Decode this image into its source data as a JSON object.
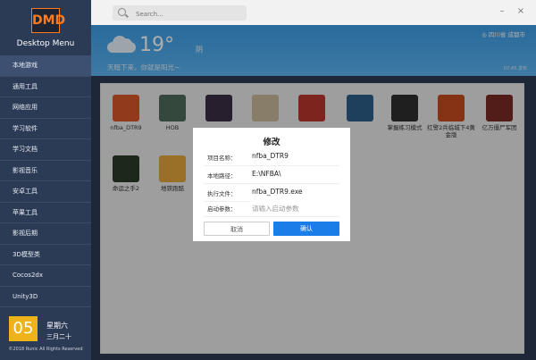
{
  "sidebar": {
    "logo_text": "DMD",
    "app_title": "Desktop Menu",
    "items": [
      {
        "label": "本地游戏",
        "active": true
      },
      {
        "label": "通用工具"
      },
      {
        "label": "网络应用"
      },
      {
        "label": "学习软件"
      },
      {
        "label": "学习文档"
      },
      {
        "label": "影视音乐"
      },
      {
        "label": "安卓工具"
      },
      {
        "label": "苹果工具"
      },
      {
        "label": "影视后期"
      },
      {
        "label": "3D模型类"
      },
      {
        "label": "Cocos2dx"
      },
      {
        "label": "Unity3D"
      }
    ],
    "date_day": "05",
    "weekday": "星期六",
    "lunar_date": "三月二十",
    "copyright": "©2018 Runic All Rights Reserved"
  },
  "topbar": {
    "search_placeholder": "Search...",
    "minimize": "–",
    "close": "×"
  },
  "weather": {
    "temperature": "19°",
    "condition": "阴",
    "slogan": "天暗下来，你就是阳光~",
    "location": "四川省 成都市",
    "publish_time": "07:45 发布"
  },
  "games": [
    {
      "name": "nfba_DTR9",
      "color": "#d8562a"
    },
    {
      "name": "HOB",
      "color": "#4d6a5c"
    },
    {
      "name": "",
      "color": "#3a2f44"
    },
    {
      "name": "",
      "color": "#c9b89a"
    },
    {
      "name": "",
      "color": "#b8352f"
    },
    {
      "name": "",
      "color": "#2e5f8a"
    },
    {
      "name": "掌握练习模式",
      "color": "#2f2f2f"
    },
    {
      "name": "红警2兵临城下4黄金版",
      "color": "#c64a1e"
    },
    {
      "name": "亿万僵尸军团",
      "color": "#7a2a25"
    },
    {
      "name": "命运之手2",
      "color": "#2c3a2a"
    },
    {
      "name": "地铁跑酷",
      "color": "#e3a63d"
    }
  ],
  "dialog": {
    "title": "修改",
    "name_label": "项目名称：",
    "name_value": "nfba_DTR9",
    "path_label": "本地路径：",
    "path_value": "E:\\NFBA\\",
    "exe_label": "执行文件：",
    "exe_value": "nfba_DTR9.exe",
    "args_label": "启动参数：",
    "args_placeholder": "请输入启动参数",
    "cancel_label": "取消",
    "ok_label": "确认"
  },
  "colors": {
    "sidebar_bg": "#2c3b55",
    "accent": "#1a7de8",
    "date_badge": "#f0b21a"
  }
}
